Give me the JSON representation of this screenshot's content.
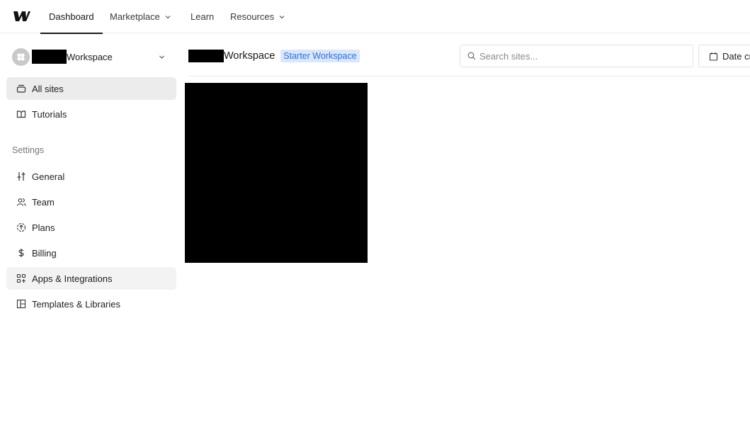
{
  "topnav": {
    "logo_icon": "webflow-logo-icon",
    "items": [
      {
        "label": "Dashboard",
        "active": true,
        "has_dropdown": false
      },
      {
        "label": "Marketplace",
        "active": false,
        "has_dropdown": true
      },
      {
        "label": "Learn",
        "active": false,
        "has_dropdown": false
      },
      {
        "label": "Resources",
        "active": false,
        "has_dropdown": true
      }
    ]
  },
  "sidebar": {
    "workspace_name_suffix": "Workspace",
    "workspace_name_redacted": true,
    "items": [
      {
        "label": "All sites",
        "icon": "sites-icon",
        "selected": true
      },
      {
        "label": "Tutorials",
        "icon": "tutorials-icon",
        "selected": false
      }
    ],
    "settings_label": "Settings",
    "settings_items": [
      {
        "label": "General",
        "icon": "sliders-icon"
      },
      {
        "label": "Team",
        "icon": "team-icon"
      },
      {
        "label": "Plans",
        "icon": "plans-upgrade-icon"
      },
      {
        "label": "Billing",
        "icon": "dollar-icon"
      },
      {
        "label": "Apps & Integrations",
        "icon": "apps-icon",
        "hovered": true
      },
      {
        "label": "Templates & Libraries",
        "icon": "templates-icon"
      }
    ]
  },
  "main": {
    "title_suffix": "Workspace",
    "title_redacted": true,
    "plan_badge": "Starter Workspace",
    "search": {
      "placeholder": "Search sites...",
      "value": ""
    },
    "sort_button_label": "Date created",
    "site_thumbnail_redacted": true
  },
  "colors": {
    "badge_bg": "#d9e6fb",
    "badge_text": "#2f6fe0",
    "selected_bg": "#ececec",
    "hover_bg": "#f3f3f3"
  }
}
